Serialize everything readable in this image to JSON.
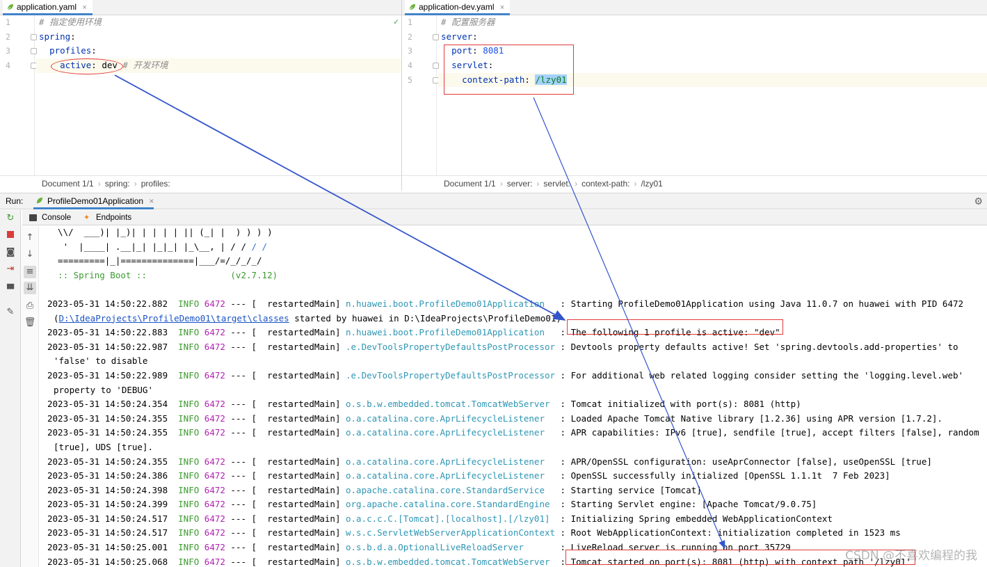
{
  "left_editor": {
    "tab_label": "application.yaml",
    "close_symbol": "×",
    "line_numbers": [
      "1",
      "2",
      "3",
      "4"
    ],
    "lines": [
      {
        "comment": "# 指定使用环境"
      },
      {
        "key": "spring",
        "colon": ":"
      },
      {
        "indent": "  ",
        "key": "profiles",
        "colon": ":"
      },
      {
        "indent": "    ",
        "key": "active",
        "colon": ": ",
        "value": "dev",
        "comment": " # 开发环境"
      }
    ],
    "breadcrumbs": [
      "Document 1/1",
      "spring:",
      "profiles:"
    ],
    "status_check": "✓"
  },
  "right_editor": {
    "tab_label": "application-dev.yaml",
    "close_symbol": "×",
    "line_numbers": [
      "1",
      "2",
      "3",
      "4",
      "5"
    ],
    "lines": [
      {
        "comment": "# 配置服务器"
      },
      {
        "key": "server",
        "colon": ":"
      },
      {
        "indent": "  ",
        "key": "port",
        "colon": ": ",
        "value": "8081"
      },
      {
        "indent": "  ",
        "key": "servlet",
        "colon": ":"
      },
      {
        "indent": "    ",
        "key": "context-path",
        "colon": ": ",
        "value": "/lzy01"
      }
    ],
    "breadcrumbs": [
      "Document 1/1",
      "server:",
      "servlet:",
      "context-path:",
      "/lzy01"
    ]
  },
  "run_panel": {
    "run_label": "Run:",
    "config_name": "ProfileDemo01Application",
    "close_symbol": "×",
    "tabs": [
      "Console",
      "Endpoints"
    ],
    "settings_icon": "gear-icon"
  },
  "console": {
    "banner": [
      "  \\\\/  ___)| |_)| | | | | || (_| |  ) ) ) )",
      "   '  |____| .__|_| |_|_| |_\\__, | / / / /",
      "  =========|_|==============|___/=/_/_/_/",
      "  :: Spring Boot ::                (v2.7.12)"
    ],
    "log_lines": [
      {
        "ts": "2023-05-31 14:50:22.882",
        "level": "INFO",
        "pid": "6472",
        "sep": " --- [  restartedMain]",
        "logger": "n.huawei.boot.ProfileDemo01Application  ",
        "msg": " : Starting ProfileDemo01Application using Java 11.0.7 on huawei with PID 6472"
      },
      {
        "wrap_prefix": "(",
        "link": "D:\\IdeaProjects\\ProfileDemo01\\target\\classes",
        "wrap_rest": " started by huawei in D:\\IdeaProjects\\ProfileDemo01)"
      },
      {
        "ts": "2023-05-31 14:50:22.883",
        "level": "INFO",
        "pid": "6472",
        "sep": " --- [  restartedMain]",
        "logger": "n.huawei.boot.ProfileDemo01Application  ",
        "msg": " : The following 1 profile is active: \"dev\""
      },
      {
        "ts": "2023-05-31 14:50:22.987",
        "level": "INFO",
        "pid": "6472",
        "sep": " --- [  restartedMain]",
        "logger": ".e.DevToolsPropertyDefaultsPostProcessor",
        "msg": " : Devtools property defaults active! Set 'spring.devtools.add-properties' to"
      },
      {
        "wrap_text": "'false' to disable"
      },
      {
        "ts": "2023-05-31 14:50:22.989",
        "level": "INFO",
        "pid": "6472",
        "sep": " --- [  restartedMain]",
        "logger": ".e.DevToolsPropertyDefaultsPostProcessor",
        "msg": " : For additional web related logging consider setting the 'logging.level.web'"
      },
      {
        "wrap_text": "property to 'DEBUG'"
      },
      {
        "ts": "2023-05-31 14:50:24.354",
        "level": "INFO",
        "pid": "6472",
        "sep": " --- [  restartedMain]",
        "logger": "o.s.b.w.embedded.tomcat.TomcatWebServer ",
        "msg": " : Tomcat initialized with port(s): 8081 (http)"
      },
      {
        "ts": "2023-05-31 14:50:24.355",
        "level": "INFO",
        "pid": "6472",
        "sep": " --- [  restartedMain]",
        "logger": "o.a.catalina.core.AprLifecycleListener  ",
        "msg": " : Loaded Apache Tomcat Native library [1.2.36] using APR version [1.7.2]."
      },
      {
        "ts": "2023-05-31 14:50:24.355",
        "level": "INFO",
        "pid": "6472",
        "sep": " --- [  restartedMain]",
        "logger": "o.a.catalina.core.AprLifecycleListener  ",
        "msg": " : APR capabilities: IPv6 [true], sendfile [true], accept filters [false], random"
      },
      {
        "wrap_text": "[true], UDS [true]."
      },
      {
        "ts": "2023-05-31 14:50:24.355",
        "level": "INFO",
        "pid": "6472",
        "sep": " --- [  restartedMain]",
        "logger": "o.a.catalina.core.AprLifecycleListener  ",
        "msg": " : APR/OpenSSL configuration: useAprConnector [false], useOpenSSL [true]"
      },
      {
        "ts": "2023-05-31 14:50:24.386",
        "level": "INFO",
        "pid": "6472",
        "sep": " --- [  restartedMain]",
        "logger": "o.a.catalina.core.AprLifecycleListener  ",
        "msg": " : OpenSSL successfully initialized [OpenSSL 1.1.1t  7 Feb 2023]"
      },
      {
        "ts": "2023-05-31 14:50:24.398",
        "level": "INFO",
        "pid": "6472",
        "sep": " --- [  restartedMain]",
        "logger": "o.apache.catalina.core.StandardService  ",
        "msg": " : Starting service [Tomcat]"
      },
      {
        "ts": "2023-05-31 14:50:24.399",
        "level": "INFO",
        "pid": "6472",
        "sep": " --- [  restartedMain]",
        "logger": "org.apache.catalina.core.StandardEngine ",
        "msg": " : Starting Servlet engine: [Apache Tomcat/9.0.75]"
      },
      {
        "ts": "2023-05-31 14:50:24.517",
        "level": "INFO",
        "pid": "6472",
        "sep": " --- [  restartedMain]",
        "logger": "o.a.c.c.C.[Tomcat].[localhost].[/lzy01] ",
        "msg": " : Initializing Spring embedded WebApplicationContext"
      },
      {
        "ts": "2023-05-31 14:50:24.517",
        "level": "INFO",
        "pid": "6472",
        "sep": " --- [  restartedMain]",
        "logger": "w.s.c.ServletWebServerApplicationContext",
        "msg": " : Root WebApplicationContext: initialization completed in 1523 ms"
      },
      {
        "ts": "2023-05-31 14:50:25.001",
        "level": "INFO",
        "pid": "6472",
        "sep": " --- [  restartedMain]",
        "logger": "o.s.b.d.a.OptionalLiveReloadServer      ",
        "msg": " : LiveReload server is running on port 35729"
      },
      {
        "ts": "2023-05-31 14:50:25.068",
        "level": "INFO",
        "pid": "6472",
        "sep": " --- [  restartedMain]",
        "logger": "o.s.b.w.embedded.tomcat.TomcatWebServer ",
        "msg": " : Tomcat started on port(s): 8081 (http) with context path '/lzy01'"
      }
    ]
  },
  "watermark": "CSDN @不喜欢编程的我",
  "colors": {
    "annotation_red": "#e03a3a",
    "arrow_blue": "#3355cc",
    "tab_underline": "#4083c9"
  }
}
